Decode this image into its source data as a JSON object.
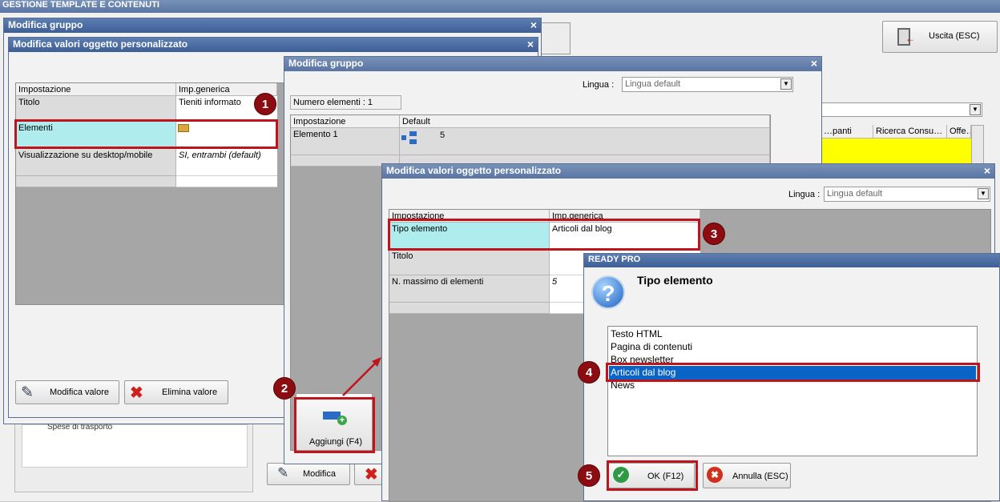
{
  "main": {
    "title": "GESTIONE TEMPLATE E CONTENUTI",
    "exit_button": "Uscita (ESC)",
    "bg_columns": [
      "…panti",
      "Ricerca Consu…",
      "Offe…"
    ],
    "bg_list_item": "Spese di trasporto",
    "bg_modify_button": "Modifica"
  },
  "win1": {
    "title": "Modifica gruppo"
  },
  "win2": {
    "title": "Modifica valori oggetto personalizzato",
    "headers": [
      "Impostazione",
      "Imp.generica"
    ],
    "rows": [
      {
        "label": "Titolo",
        "value": "Tieniti informato"
      },
      {
        "label": "Elementi",
        "value": ""
      },
      {
        "label": "Visualizzazione su desktop/mobile",
        "value": "SI, entrambi (default)"
      }
    ],
    "btn_modify": "Modifica valore",
    "btn_delete": "Elimina valore"
  },
  "win3": {
    "title": "Modifica gruppo",
    "lingua_label": "Lingua :",
    "lingua_value": "Lingua default",
    "count_label": "Numero elementi : 1",
    "headers": [
      "Impostazione",
      "Default"
    ],
    "rows": [
      {
        "label": "Elemento 1",
        "value": "5"
      }
    ],
    "add_button": "Aggiungi (F4)"
  },
  "win4": {
    "title": "Modifica valori oggetto personalizzato",
    "lingua_label": "Lingua :",
    "lingua_value": "Lingua default",
    "headers": [
      "Impostazione",
      "Imp.generica"
    ],
    "rows": [
      {
        "label": "Tipo elemento",
        "value": "Articoli dal blog"
      },
      {
        "label": "Titolo",
        "value": ""
      },
      {
        "label": "N. massimo di elementi",
        "value": "5"
      }
    ]
  },
  "dialog": {
    "title": "READY PRO",
    "heading": "Tipo elemento",
    "options": [
      "Testo HTML",
      "Pagina di contenuti",
      "Box newsletter",
      "Articoli dal blog",
      "News"
    ],
    "selected": "Articoli dal blog",
    "ok": "OK (F12)",
    "cancel": "Annulla (ESC)"
  },
  "steps": [
    "1",
    "2",
    "3",
    "4",
    "5"
  ],
  "colors": {
    "accent": "#3e5f96",
    "highlight": "#aeecee",
    "selection": "#0a64c8",
    "marker": "#8b0d12",
    "yellow": "#ffff00"
  },
  "icons": [
    "exit-door-icon",
    "lock-folder-icon",
    "tree-structure-icon",
    "add-element-icon",
    "edit-pencil-icon",
    "delete-x-icon",
    "question-icon",
    "ok-check-icon",
    "cancel-x-icon"
  ]
}
